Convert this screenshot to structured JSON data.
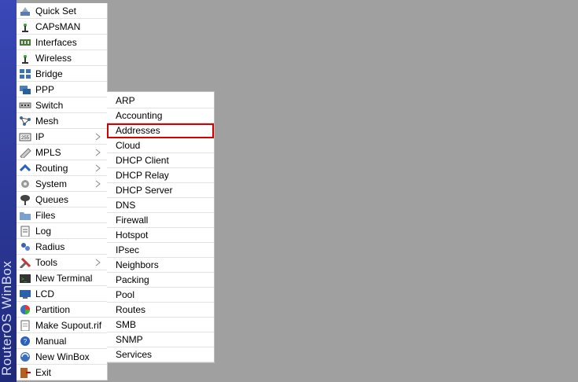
{
  "brand": {
    "text": "RouterOS WinBox"
  },
  "main_menu": [
    {
      "label": "Quick Set",
      "icon": "quick-set-icon",
      "submenu": false
    },
    {
      "label": "CAPsMAN",
      "icon": "capsman-icon",
      "submenu": false
    },
    {
      "label": "Interfaces",
      "icon": "interfaces-icon",
      "submenu": false
    },
    {
      "label": "Wireless",
      "icon": "wireless-icon",
      "submenu": false
    },
    {
      "label": "Bridge",
      "icon": "bridge-icon",
      "submenu": false
    },
    {
      "label": "PPP",
      "icon": "ppp-icon",
      "submenu": false
    },
    {
      "label": "Switch",
      "icon": "switch-icon",
      "submenu": false
    },
    {
      "label": "Mesh",
      "icon": "mesh-icon",
      "submenu": false
    },
    {
      "label": "IP",
      "icon": "ip-icon",
      "submenu": true
    },
    {
      "label": "MPLS",
      "icon": "mpls-icon",
      "submenu": true
    },
    {
      "label": "Routing",
      "icon": "routing-icon",
      "submenu": true
    },
    {
      "label": "System",
      "icon": "system-icon",
      "submenu": true
    },
    {
      "label": "Queues",
      "icon": "queues-icon",
      "submenu": false
    },
    {
      "label": "Files",
      "icon": "files-icon",
      "submenu": false
    },
    {
      "label": "Log",
      "icon": "log-icon",
      "submenu": false
    },
    {
      "label": "Radius",
      "icon": "radius-icon",
      "submenu": false
    },
    {
      "label": "Tools",
      "icon": "tools-icon",
      "submenu": true
    },
    {
      "label": "New Terminal",
      "icon": "terminal-icon",
      "submenu": false
    },
    {
      "label": "LCD",
      "icon": "lcd-icon",
      "submenu": false
    },
    {
      "label": "Partition",
      "icon": "partition-icon",
      "submenu": false
    },
    {
      "label": "Make Supout.rif",
      "icon": "supout-icon",
      "submenu": false
    },
    {
      "label": "Manual",
      "icon": "manual-icon",
      "submenu": false
    },
    {
      "label": "New WinBox",
      "icon": "winbox-icon",
      "submenu": false
    },
    {
      "label": "Exit",
      "icon": "exit-icon",
      "submenu": false
    }
  ],
  "ip_submenu": {
    "selected": "Addresses",
    "items": [
      "ARP",
      "Accounting",
      "Addresses",
      "Cloud",
      "DHCP Client",
      "DHCP Relay",
      "DHCP Server",
      "DNS",
      "Firewall",
      "Hotspot",
      "IPsec",
      "Neighbors",
      "Packing",
      "Pool",
      "Routes",
      "SMB",
      "SNMP",
      "Services"
    ]
  },
  "colors": {
    "brand_bar": "#2f3ca0",
    "selection_outline": "#d40000",
    "workspace": "#a0a0a0"
  }
}
